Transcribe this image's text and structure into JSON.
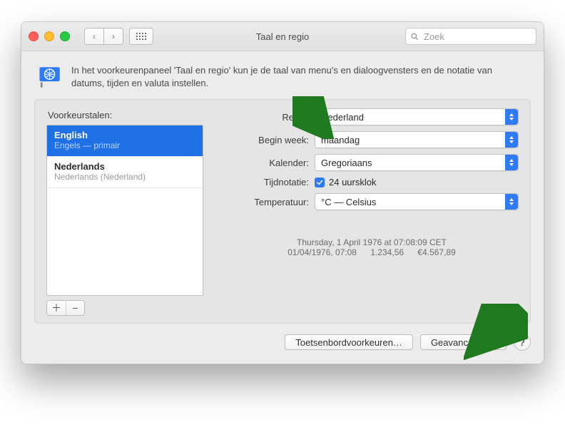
{
  "window": {
    "title": "Taal en regio",
    "search_placeholder": "Zoek"
  },
  "intro": {
    "text": "In het voorkeurenpaneel 'Taal en regio' kun je de taal van menu's en dialoogvensters en de notatie van datums, tijden en valuta instellen."
  },
  "languages": {
    "label": "Voorkeurstalen:",
    "items": [
      {
        "name": "English",
        "sub": "Engels — primair",
        "selected": true
      },
      {
        "name": "Nederlands",
        "sub": "Nederlands (Nederland)",
        "selected": false
      }
    ]
  },
  "form": {
    "region": {
      "label": "Regio:",
      "value": "Nederland"
    },
    "first_day": {
      "label": "Begin week:",
      "value": "maandag"
    },
    "calendar": {
      "label": "Kalender:",
      "value": "Gregoriaans"
    },
    "time_format": {
      "label": "Tijdnotatie:",
      "checkbox_label": "24 uursklok",
      "checked": true
    },
    "temperature": {
      "label": "Temperatuur:",
      "value": "°C — Celsius"
    }
  },
  "samples": {
    "line1": "Thursday, 1 April 1976 at 07:08:09 CET",
    "line2": {
      "date": "01/04/1976, 07:08",
      "number": "1.234,56",
      "currency": "€4.567,89"
    }
  },
  "footer": {
    "keyboard": "Toetsenbordvoorkeuren…",
    "advanced": "Geavanceerd…",
    "help": "?"
  },
  "colors": {
    "accent": "#2f7bf6",
    "arrow": "#1f7a1f"
  }
}
